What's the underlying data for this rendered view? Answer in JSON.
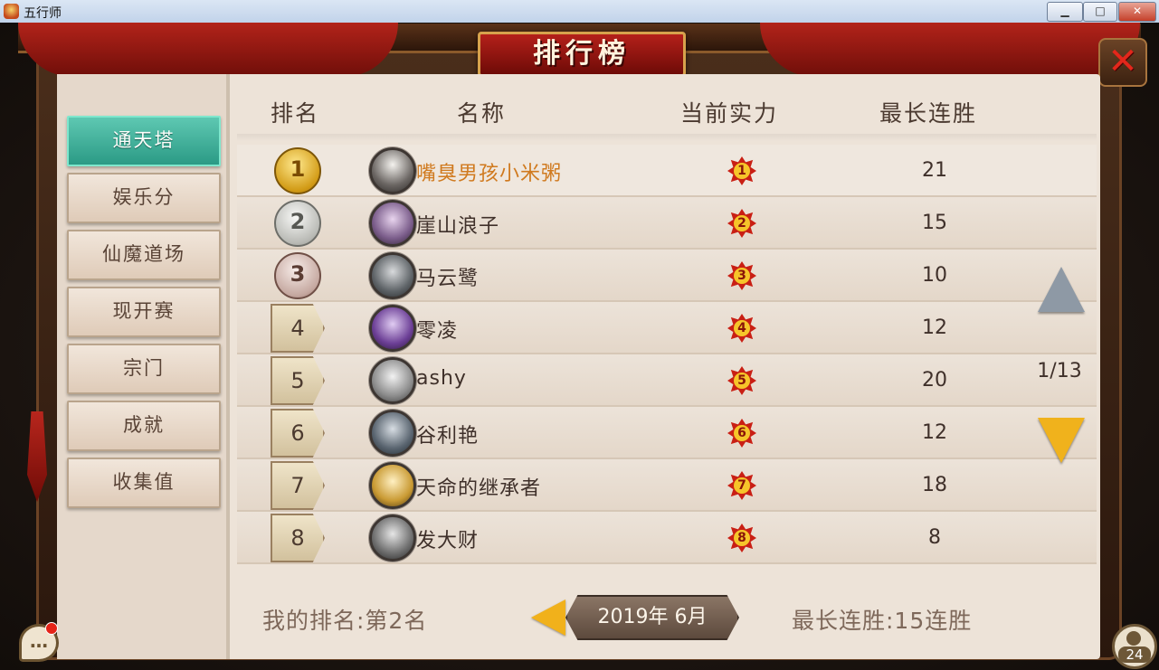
{
  "window": {
    "title": "五行师",
    "min": "▁",
    "max": "□",
    "close": "✕"
  },
  "screen_title": "排行榜",
  "close_glyph": "✕",
  "tabs": [
    {
      "label": "通天塔",
      "active": true
    },
    {
      "label": "娱乐分",
      "active": false
    },
    {
      "label": "仙魔道场",
      "active": false
    },
    {
      "label": "现开赛",
      "active": false
    },
    {
      "label": "宗门",
      "active": false
    },
    {
      "label": "成就",
      "active": false
    },
    {
      "label": "收集值",
      "active": false
    }
  ],
  "columns": {
    "rank": "排名",
    "name": "名称",
    "power": "当前实力",
    "streak": "最长连胜"
  },
  "rows": [
    {
      "rank": "1",
      "name": "嘴臭男孩小米粥",
      "power": "1",
      "streak": "21"
    },
    {
      "rank": "2",
      "name": "崖山浪子",
      "power": "2",
      "streak": "15"
    },
    {
      "rank": "3",
      "name": "马云鹭",
      "power": "3",
      "streak": "10"
    },
    {
      "rank": "4",
      "name": "零凌",
      "power": "4",
      "streak": "12"
    },
    {
      "rank": "5",
      "name": "ashy",
      "power": "5",
      "streak": "20"
    },
    {
      "rank": "6",
      "name": "谷利艳",
      "power": "6",
      "streak": "12"
    },
    {
      "rank": "7",
      "name": "天命的继承者",
      "power": "7",
      "streak": "18"
    },
    {
      "rank": "8",
      "name": "发大财",
      "power": "8",
      "streak": "8"
    }
  ],
  "pager": {
    "page": "1/13"
  },
  "footer": {
    "my_rank": "我的排名:第2名",
    "date": "2019年  6月",
    "my_streak": "最长连胜:15连胜"
  },
  "chat_glyph": "…",
  "friends_count": "24",
  "colors": {
    "accent_tab": "#2b9a85",
    "top_name": "#d07a1f",
    "gold": "#d29b16",
    "power_star": "#c91f14"
  }
}
